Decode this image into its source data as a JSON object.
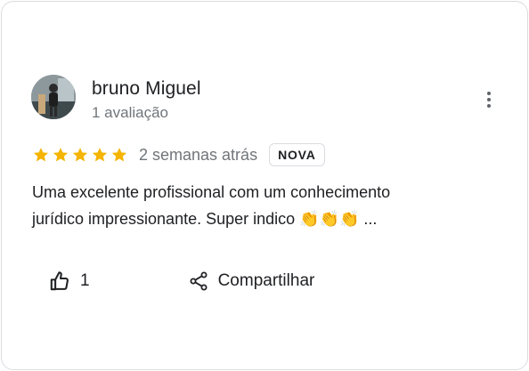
{
  "review": {
    "author": {
      "name": "bruno Miguel",
      "meta": "1 avaliação"
    },
    "rating": 5,
    "date": "2 semanas atrás",
    "badge": "NOVA",
    "text_line1": "Uma excelente profissional com um conhecimento",
    "text_line2_before": "jurídico impressionante. Super indico ",
    "emojis": "👏👏👏",
    "ellipsis": " ...",
    "likes": "1",
    "share_label": "Compartilhar",
    "icons": [
      "more-vert-icon",
      "star-icon",
      "thumb-up-icon",
      "share-icon",
      "clap-emoji"
    ],
    "colors": {
      "star": "#f4b400",
      "secondary_text": "#70757a",
      "border": "#dadce0"
    }
  }
}
